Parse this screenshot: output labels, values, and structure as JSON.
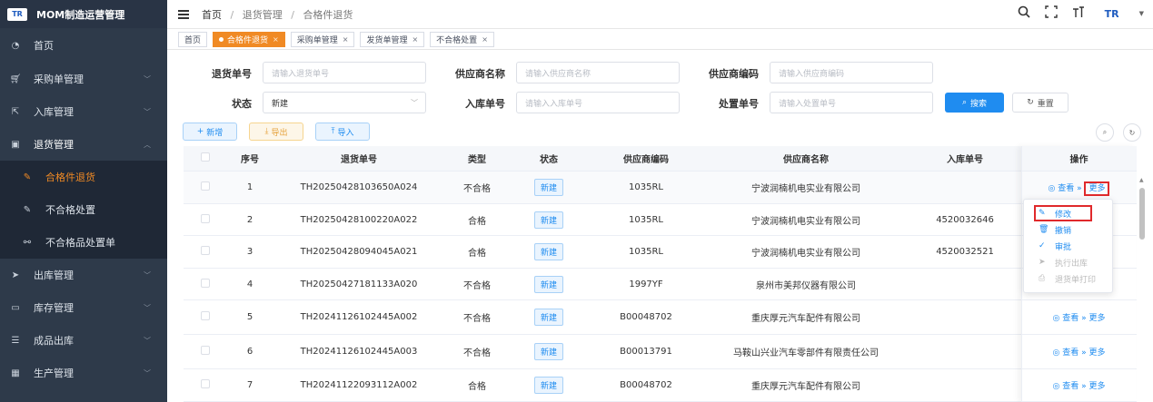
{
  "app": {
    "title": "MOM制造运营管理",
    "logo_text": "TR"
  },
  "sidebar": {
    "items": [
      {
        "label": "首页",
        "icon": "dashboard-icon"
      },
      {
        "label": "采购单管理",
        "icon": "cart-icon"
      },
      {
        "label": "入库管理",
        "icon": "inbound-icon"
      },
      {
        "label": "退货管理",
        "icon": "return-icon"
      },
      {
        "label": "合格件退货",
        "icon": "edit-icon"
      },
      {
        "label": "不合格处置",
        "icon": "edit-icon"
      },
      {
        "label": "不合格品处置单",
        "icon": "link-icon"
      },
      {
        "label": "出库管理",
        "icon": "send-icon"
      },
      {
        "label": "库存管理",
        "icon": "monitor-icon"
      },
      {
        "label": "成品出库",
        "icon": "list-icon"
      },
      {
        "label": "生产管理",
        "icon": "factory-icon"
      }
    ]
  },
  "breadcrumb": {
    "home": "首页",
    "level1": "退货管理",
    "level2": "合格件退货"
  },
  "tags": [
    {
      "label": "首页"
    },
    {
      "label": "合格件退货"
    },
    {
      "label": "采购单管理"
    },
    {
      "label": "发货单管理"
    },
    {
      "label": "不合格处置"
    }
  ],
  "search": {
    "return_no_label": "退货单号",
    "return_no_placeholder": "请输入退货单号",
    "supplier_name_label": "供应商名称",
    "supplier_name_placeholder": "请输入供应商名称",
    "supplier_code_label": "供应商编码",
    "supplier_code_placeholder": "请输入供应商编码",
    "status_label": "状态",
    "status_value": "新建",
    "inbound_no_label": "入库单号",
    "inbound_no_placeholder": "请输入入库单号",
    "disposal_no_label": "处置单号",
    "disposal_no_placeholder": "请输入处置单号",
    "search_button": "搜索",
    "reset_button": "重置"
  },
  "toolbar": {
    "add": "新增",
    "export": "导出",
    "import": "导入"
  },
  "table": {
    "headers": [
      "序号",
      "退货单号",
      "类型",
      "状态",
      "供应商编码",
      "供应商名称",
      "入库单号",
      "操作"
    ],
    "view_label": "查看",
    "more_label": "更多",
    "rows": [
      {
        "no": "1",
        "return_no": "TH20250428103650A024",
        "type": "不合格",
        "status": "新建",
        "supplier_code": "1035RL",
        "supplier_name": "宁波润楠机电实业有限公司",
        "inbound_no": ""
      },
      {
        "no": "2",
        "return_no": "TH20250428100220A022",
        "type": "合格",
        "status": "新建",
        "supplier_code": "1035RL",
        "supplier_name": "宁波润楠机电实业有限公司",
        "inbound_no": "4520032646"
      },
      {
        "no": "3",
        "return_no": "TH20250428094045A021",
        "type": "合格",
        "status": "新建",
        "supplier_code": "1035RL",
        "supplier_name": "宁波润楠机电实业有限公司",
        "inbound_no": "4520032521"
      },
      {
        "no": "4",
        "return_no": "TH20250427181133A020",
        "type": "不合格",
        "status": "新建",
        "supplier_code": "1997YF",
        "supplier_name": "泉州市美邦仪器有限公司",
        "inbound_no": ""
      },
      {
        "no": "5",
        "return_no": "TH20241126102445A002",
        "type": "不合格",
        "status": "新建",
        "supplier_code": "B00048702",
        "supplier_name": "重庆厚元汽车配件有限公司",
        "inbound_no": ""
      },
      {
        "no": "6",
        "return_no": "TH20241126102445A003",
        "type": "不合格",
        "status": "新建",
        "supplier_code": "B00013791",
        "supplier_name": "马鞍山兴业汽车零部件有限责任公司",
        "inbound_no": ""
      },
      {
        "no": "7",
        "return_no": "TH20241122093112A002",
        "type": "合格",
        "status": "新建",
        "supplier_code": "B00048702",
        "supplier_name": "重庆厚元汽车配件有限公司",
        "inbound_no": ""
      }
    ]
  },
  "dropdown": {
    "items": [
      {
        "label": "修改",
        "icon": "edit-icon"
      },
      {
        "label": "撤销",
        "icon": "trash-icon"
      },
      {
        "label": "审批",
        "icon": "check-icon"
      },
      {
        "label": "执行出库",
        "icon": "send-icon"
      },
      {
        "label": "退货单打印",
        "icon": "print-icon"
      }
    ]
  }
}
